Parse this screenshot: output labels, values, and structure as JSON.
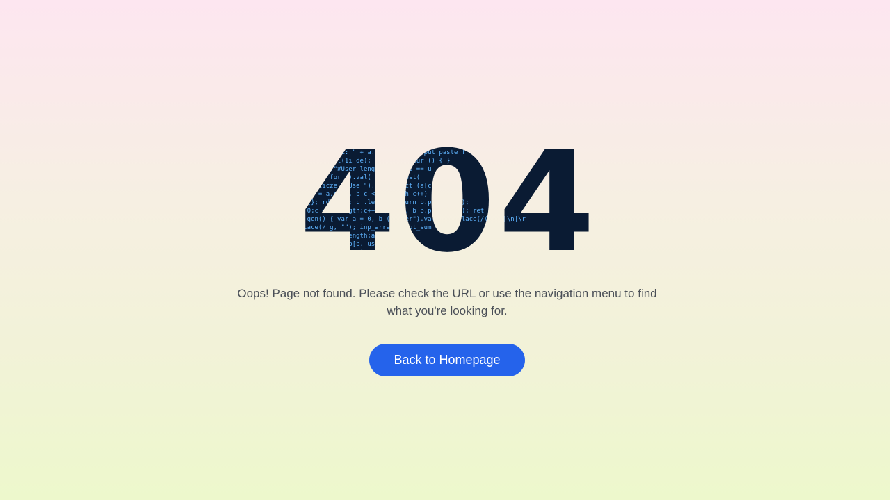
{
  "error": {
    "code": "404",
    "code_style": "code-texture"
  },
  "message": "Oops! Page not found. Please check the URL or use the navigation menu to find what you're looking for.",
  "cta": {
    "label": "Back to Homepage"
  },
  "colors": {
    "button_bg": "#2563eb",
    "button_text": "#ffffff",
    "code_fill_dark": "#0a1b33",
    "code_text_blue": "#5fb4ff",
    "message_text": "#4a4f57"
  }
}
